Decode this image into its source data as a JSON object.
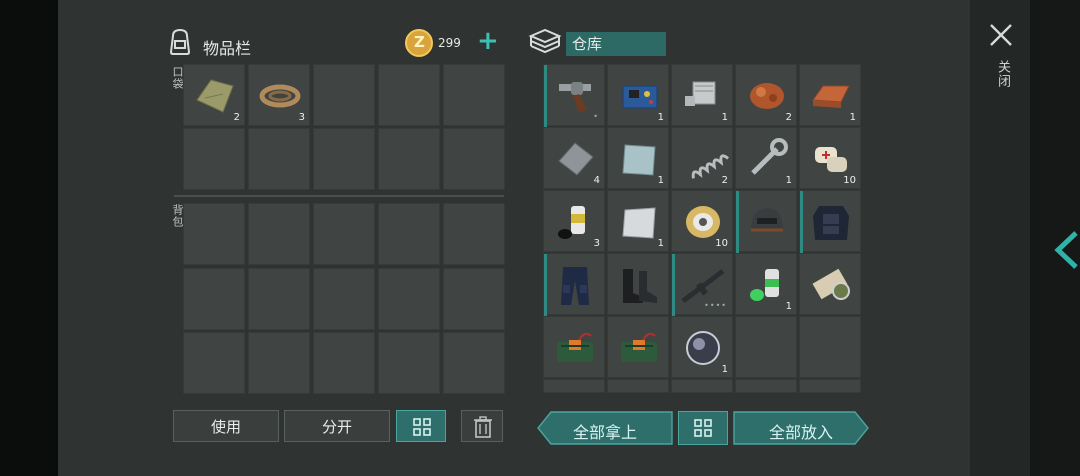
{
  "inventory": {
    "title": "物品栏",
    "coins": "299",
    "add_coin": "+",
    "pocket_label": "口袋",
    "backpack_label": "背包",
    "pocket_items": [
      {
        "name": "cloth-item",
        "count": "2"
      },
      {
        "name": "rope-item",
        "count": "3"
      }
    ],
    "use_label": "使用",
    "split_label": "分开"
  },
  "storage": {
    "title": "仓库",
    "items": [
      {
        "name": "revolver-item",
        "count": "",
        "marked": true
      },
      {
        "name": "circuit-board-item",
        "count": "1"
      },
      {
        "name": "engine-part-item",
        "count": "1"
      },
      {
        "name": "copper-ore-item",
        "count": "2"
      },
      {
        "name": "copper-ingot-item",
        "count": "1"
      },
      {
        "name": "metal-plate-item",
        "count": "4"
      },
      {
        "name": "steel-plate-item",
        "count": "1"
      },
      {
        "name": "spring-item",
        "count": "2"
      },
      {
        "name": "wrench-item",
        "count": "1"
      },
      {
        "name": "bandage-item",
        "count": "10"
      },
      {
        "name": "spray-can-item",
        "count": "3"
      },
      {
        "name": "aluminum-plate-item",
        "count": "1"
      },
      {
        "name": "wire-spool-item",
        "count": "10"
      },
      {
        "name": "helmet-item",
        "count": "",
        "marked": true
      },
      {
        "name": "police-vest-item",
        "count": "",
        "marked": true
      },
      {
        "name": "police-pants-item",
        "count": "",
        "marked": true
      },
      {
        "name": "boots-item",
        "count": ""
      },
      {
        "name": "rifle-item",
        "count": "",
        "marked": true
      },
      {
        "name": "green-spray-can-item",
        "count": "1"
      },
      {
        "name": "map-scroll-item",
        "count": ""
      },
      {
        "name": "explosive-pack-item",
        "count": ""
      },
      {
        "name": "explosive-pack-item",
        "count": ""
      },
      {
        "name": "lens-item",
        "count": "1"
      }
    ],
    "take_all_label": "全部拿上",
    "put_all_label": "全部放入"
  },
  "close_label": "关闭"
}
